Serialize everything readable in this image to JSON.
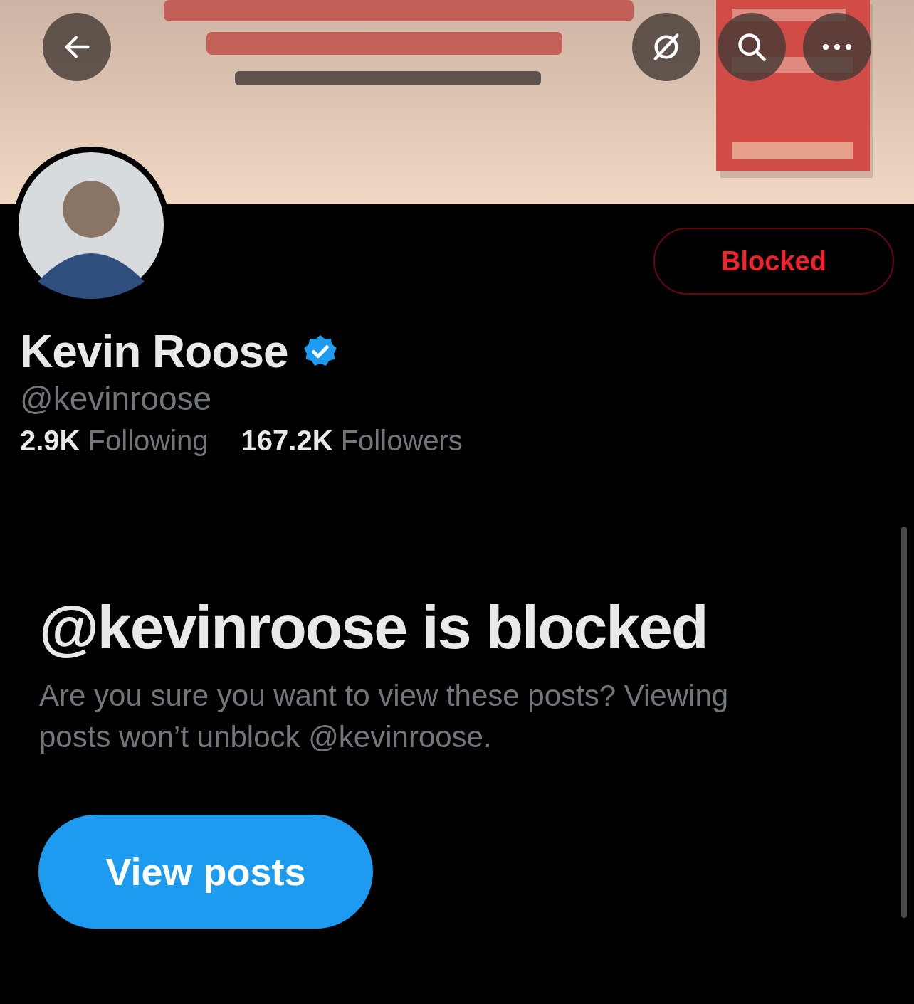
{
  "profile": {
    "name": "Kevin Roose",
    "verified": true,
    "handle": "@kevinroose",
    "action_button": {
      "label": "Blocked"
    },
    "stats": [
      {
        "text": "**2.9K** Following"
      },
      {
        "text": "**167.2K** Followers"
      }
    ]
  },
  "blocked_notice": {
    "title": "@kevinroose is blocked",
    "message": "Are you sure you want to view these posts? Viewing posts won’t unblock @kevinroose.",
    "button": "View posts"
  }
}
